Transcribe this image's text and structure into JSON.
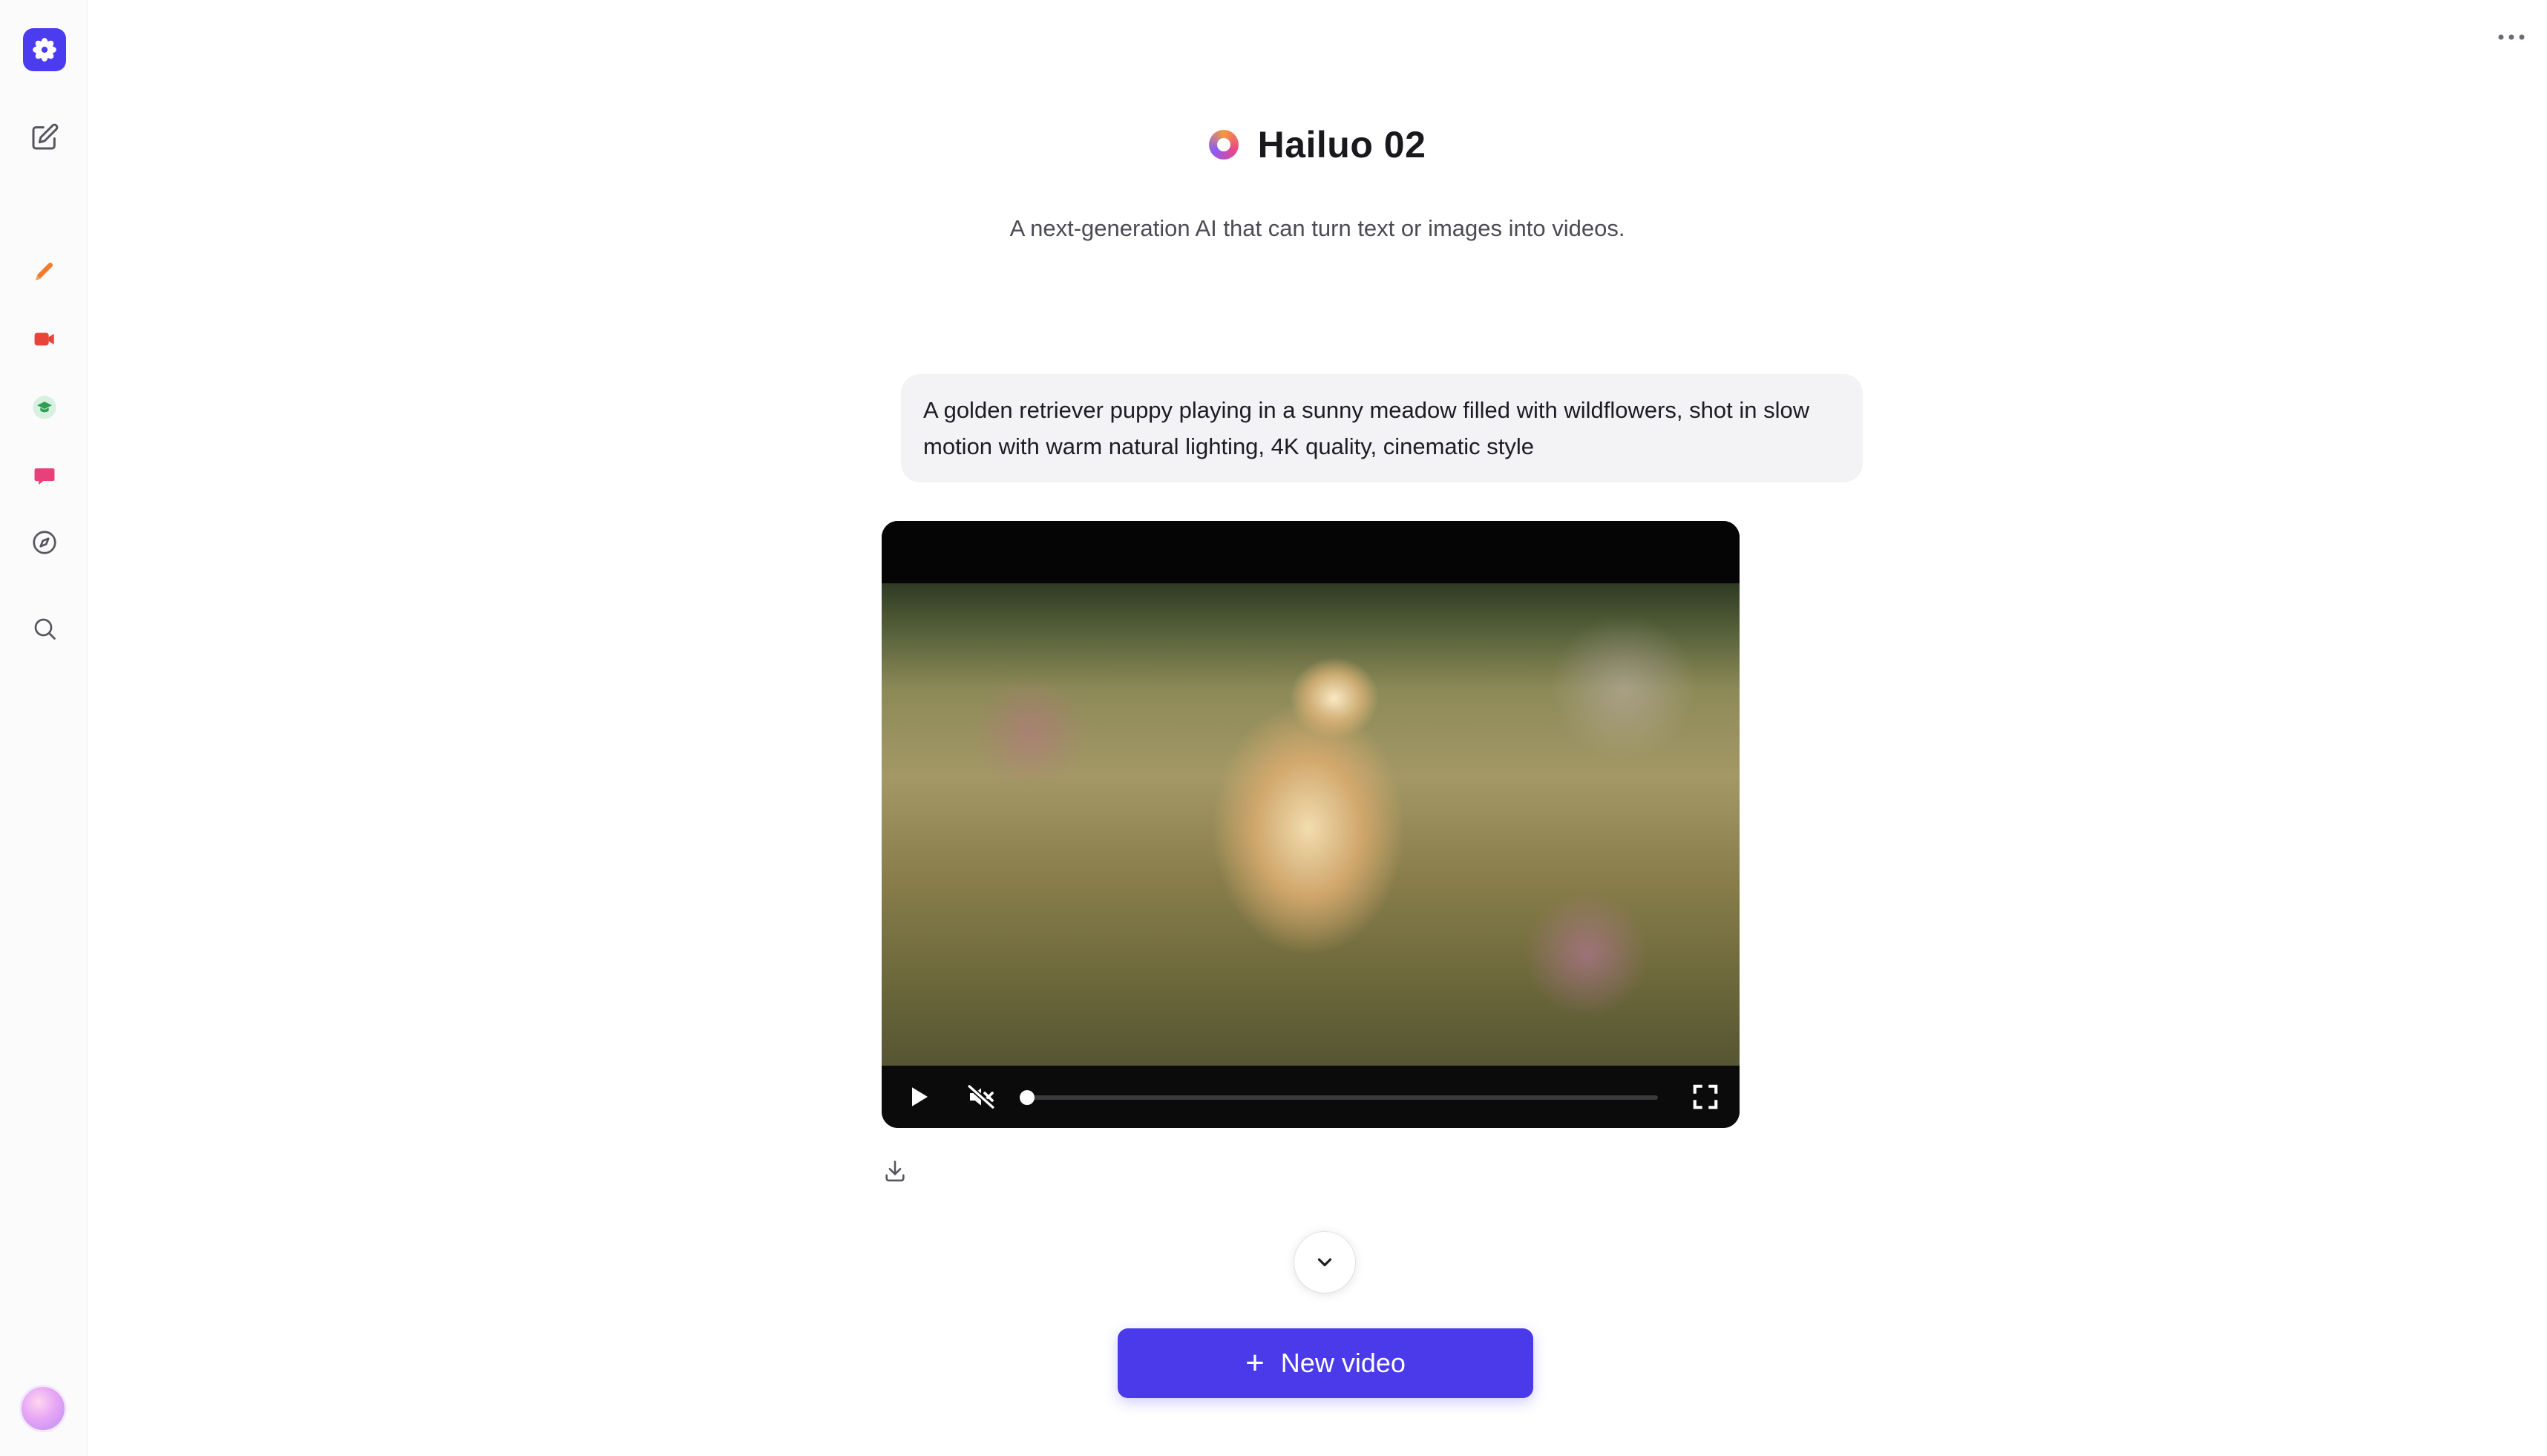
{
  "app": {
    "title": "Hailuo 02",
    "subtitle": "A next-generation AI that can turn text or images into videos."
  },
  "sidebar": {
    "items": [
      {
        "name": "logo",
        "icon": "asterisk-flower-icon"
      },
      {
        "name": "new-chat",
        "icon": "compose-icon"
      },
      {
        "name": "draw",
        "icon": "pen-icon",
        "color": "#f07b2e"
      },
      {
        "name": "video",
        "icon": "video-camera-icon",
        "color": "#e8443a"
      },
      {
        "name": "learn",
        "icon": "graduation-cap-icon",
        "color": "#2e9e55"
      },
      {
        "name": "chat",
        "icon": "chat-bubble-icon",
        "color": "#e8407a"
      },
      {
        "name": "explore",
        "icon": "compass-icon"
      },
      {
        "name": "search",
        "icon": "search-icon"
      }
    ]
  },
  "conversation": {
    "prompt": "A golden retriever puppy playing in a sunny meadow filled with wildflowers, shot in slow motion with warm natural lighting, 4K quality, cinematic style"
  },
  "video": {
    "playing": false,
    "muted": true,
    "progress": 0.0
  },
  "actions": {
    "new_video_label": "New video"
  },
  "colors": {
    "accent": "#4a3aea",
    "bubble": "#f3f3f6"
  }
}
